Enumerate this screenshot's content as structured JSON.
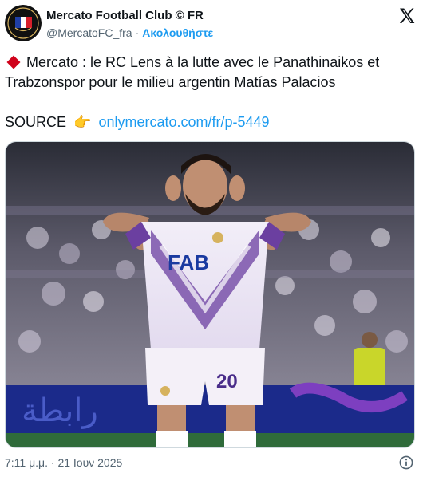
{
  "account": {
    "name": "Mercato Football Club © FR",
    "handle": "@MercatoFC_fra",
    "separator": "·",
    "follow_label": "Ακολουθήστε",
    "avatar_icon": "club-crest-icon",
    "logo_icon": "x-logo-icon"
  },
  "tweet": {
    "headline": "Mercato : le RC Lens à la lutte avec le Panathinaikos et Trabzonspor pour le milieu argentin Matías Palacios",
    "source_label": "SOURCE",
    "pointing_emoji": "👉",
    "source_link": "onlymercato.com/fr/p-5449",
    "diamond_icon": "red-diamond-icon"
  },
  "photo": {
    "sponsor": "FAB",
    "shirt_number": "20",
    "board_text": "رابطة"
  },
  "footer": {
    "timestamp": "7:11 μ.μ. · 21 Ιουν 2025",
    "info_icon": "info-icon"
  },
  "colors": {
    "accent": "#1d9bf0",
    "text": "#0f1419",
    "muted": "#536471",
    "diamond": "#d0021b",
    "kit_purple": "#6b3fa0"
  }
}
